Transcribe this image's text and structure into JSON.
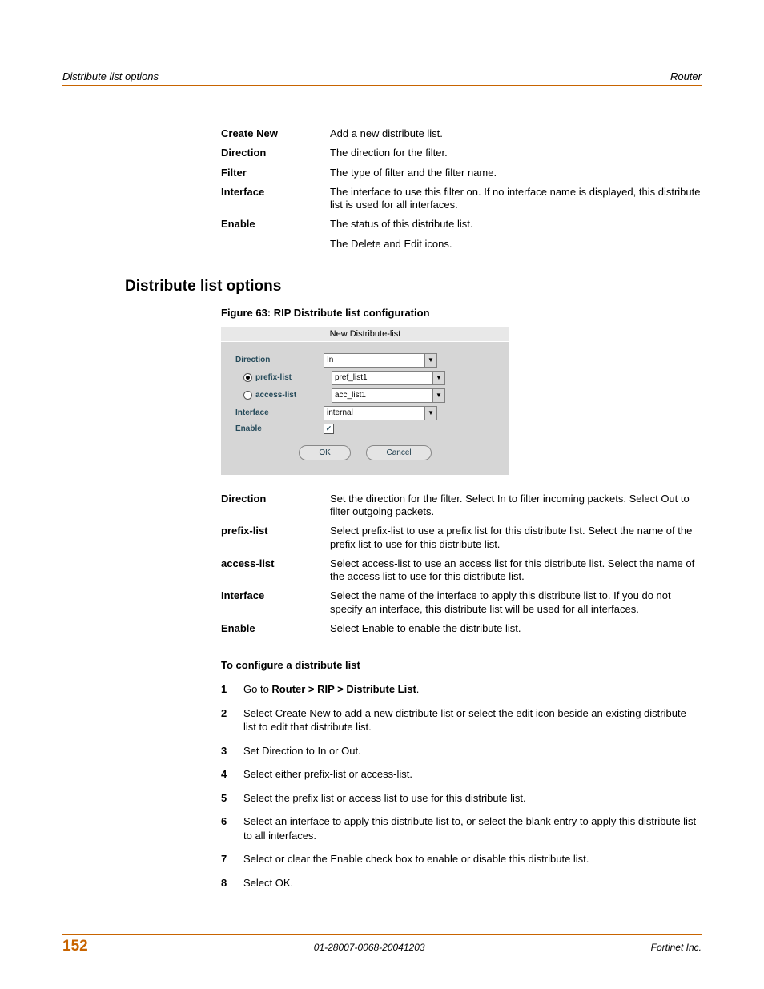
{
  "header": {
    "left": "Distribute list options",
    "right": "Router"
  },
  "top_defs": [
    {
      "term": "Create New",
      "desc": "Add a new distribute list."
    },
    {
      "term": "Direction",
      "desc": "The direction for the filter."
    },
    {
      "term": "Filter",
      "desc": "The type of filter and the filter name."
    },
    {
      "term": "Interface",
      "desc": "The interface to use this filter on. If no interface name is displayed, this distribute list is used for all interfaces."
    },
    {
      "term": "Enable",
      "desc": "The status of this distribute list."
    },
    {
      "term": "",
      "desc": "The Delete and Edit icons."
    }
  ],
  "section_heading": "Distribute list options",
  "figure_caption": "Figure 63: RIP Distribute list configuration",
  "screenshot": {
    "title": "New Distribute-list",
    "direction_label": "Direction",
    "direction_value": "In",
    "prefix_label": "prefix-list",
    "prefix_value": "pref_list1",
    "access_label": "access-list",
    "access_value": "acc_list1",
    "interface_label": "Interface",
    "interface_value": "internal",
    "enable_label": "Enable",
    "ok": "OK",
    "cancel": "Cancel"
  },
  "option_defs": [
    {
      "term": "Direction",
      "desc": "Set the direction for the filter. Select In to filter incoming packets. Select Out to filter outgoing packets."
    },
    {
      "term": "prefix-list",
      "desc": "Select prefix-list to use a prefix list for this distribute list. Select the name of the prefix list to use for this distribute list."
    },
    {
      "term": "access-list",
      "desc": "Select access-list to use an access list for this distribute list. Select the name of the access list to use for this distribute list."
    },
    {
      "term": "Interface",
      "desc": "Select the name of the interface to apply this distribute list to. If you do not specify an interface, this distribute list will be used for all interfaces."
    },
    {
      "term": "Enable",
      "desc": "Select Enable to enable the distribute list."
    }
  ],
  "procedure_title": "To configure a distribute list",
  "steps": {
    "s1_a": "Go to ",
    "s1_b": "Router > RIP > Distribute List",
    "s1_c": ".",
    "s2": "Select Create New to add a new distribute list or select the edit icon beside an existing distribute list to edit that distribute list.",
    "s3": "Set Direction to In or Out.",
    "s4": "Select either prefix-list or access-list.",
    "s5": "Select the prefix list or access list to use for this distribute list.",
    "s6": "Select an interface to apply this distribute list to, or select the blank entry to apply this distribute list to all interfaces.",
    "s7": "Select or clear the Enable check box to enable or disable this distribute list.",
    "s8": "Select OK."
  },
  "footer": {
    "page": "152",
    "docid": "01-28007-0068-20041203",
    "company": "Fortinet Inc."
  }
}
